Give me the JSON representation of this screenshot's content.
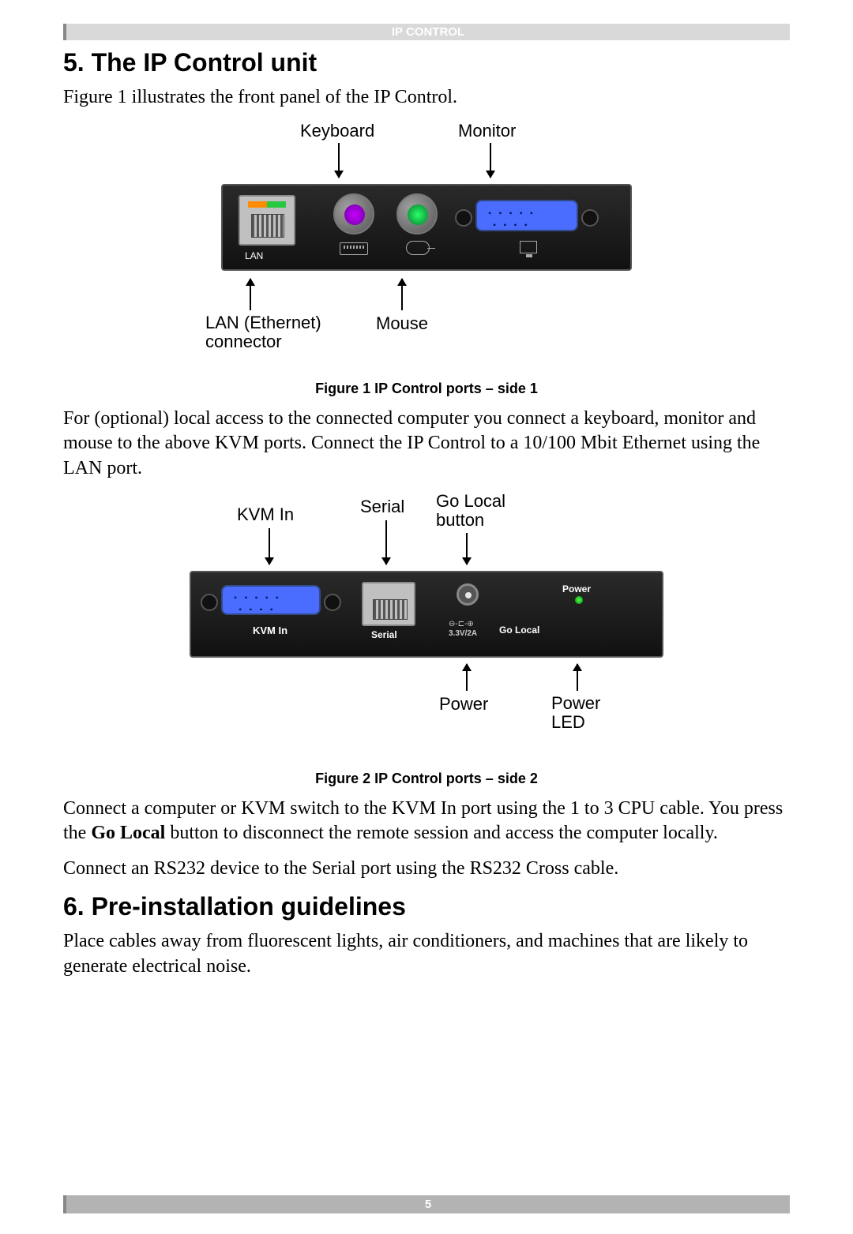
{
  "header": {
    "title": "IP CONTROL"
  },
  "sections": {
    "s5": {
      "heading": "5. The IP Control unit"
    },
    "s6": {
      "heading": "6. Pre-installation guidelines"
    }
  },
  "paragraphs": {
    "p1": "Figure 1 illustrates the front panel of the IP Control.",
    "p2": "For (optional) local access to the connected computer you connect a keyboard, monitor and mouse to the above KVM ports. Connect the IP Control to a 10/100 Mbit Ethernet using the LAN port.",
    "p3a": "Connect a computer or KVM switch to the KVM In port using the 1 to 3 CPU cable. You press the ",
    "p3b": "Go Local",
    "p3c": " button to disconnect the remote session and access the computer locally.",
    "p4": "Connect an RS232 device to the Serial port using the RS232 Cross cable.",
    "p5": "Place cables away from fluorescent lights, air conditioners, and machines that are likely to generate electrical noise."
  },
  "figures": {
    "f1": {
      "caption": "Figure 1 IP Control ports – side 1",
      "labels": {
        "keyboard": "Keyboard",
        "monitor": "Monitor",
        "lan": "LAN",
        "lan_eth": "LAN (Ethernet) connector",
        "mouse": "Mouse"
      },
      "pins": "• • • • •\n • • • •"
    },
    "f2": {
      "caption": "Figure 2 IP Control ports – side 2",
      "labels": {
        "kvmin_top": "KVM In",
        "serial_top": "Serial",
        "golocal": "Go Local button",
        "kvmin": "KVM In",
        "serial": "Serial",
        "golocal_dev": "Go Local",
        "dc_sym": "⊖-⊏-⊕",
        "dc": "3.3V/2A",
        "power_txt": "Power",
        "power": "Power",
        "powerled": "Power LED"
      }
    }
  },
  "footer": {
    "page": "5"
  }
}
